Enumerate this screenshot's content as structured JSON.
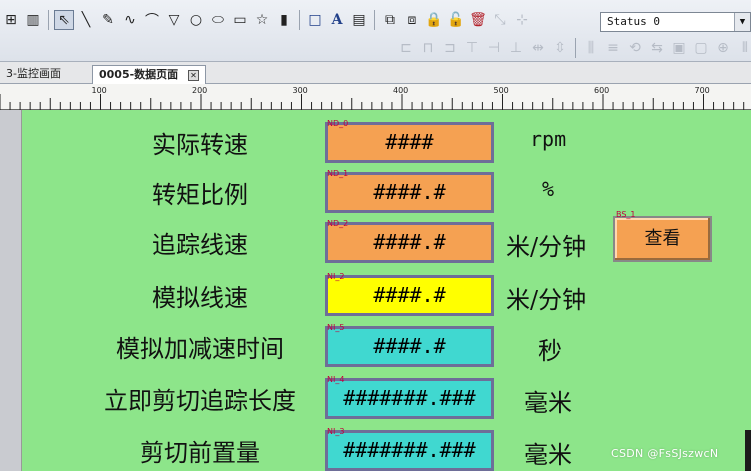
{
  "toolbar": {
    "row1_icons": [
      {
        "name": "grid-icon",
        "glyph": "⊞",
        "style": ""
      },
      {
        "name": "chart-icon",
        "glyph": "▥",
        "style": ""
      },
      {
        "name": "sep",
        "glyph": "",
        "style": "sep"
      },
      {
        "name": "select-pointer-icon",
        "glyph": "⇖",
        "style": "sel"
      },
      {
        "name": "line-tool-icon",
        "glyph": "╲",
        "style": ""
      },
      {
        "name": "pen-tool-icon",
        "glyph": "✎",
        "style": ""
      },
      {
        "name": "polyline-tool-icon",
        "glyph": "∿",
        "style": ""
      },
      {
        "name": "arc-tool-icon",
        "glyph": "⌒",
        "style": ""
      },
      {
        "name": "polygon-tool-icon",
        "glyph": "▽",
        "style": ""
      },
      {
        "name": "circle-tool-icon",
        "glyph": "○",
        "style": ""
      },
      {
        "name": "ellipse-tool-icon",
        "glyph": "⬭",
        "style": ""
      },
      {
        "name": "rectangle-tool-icon",
        "glyph": "▭",
        "style": ""
      },
      {
        "name": "star-tool-icon",
        "glyph": "☆",
        "style": ""
      },
      {
        "name": "bar-tool-icon",
        "glyph": "▮",
        "style": ""
      },
      {
        "name": "sep",
        "glyph": "",
        "style": "sep"
      },
      {
        "name": "frame-tool-icon",
        "glyph": "□",
        "style": "blue"
      },
      {
        "name": "text-tool-icon",
        "glyph": "A",
        "style": "blue"
      },
      {
        "name": "picture-tool-icon",
        "glyph": "▤",
        "style": ""
      },
      {
        "name": "sep",
        "glyph": "",
        "style": "sep"
      },
      {
        "name": "group-icon",
        "glyph": "⧉",
        "style": ""
      },
      {
        "name": "ungroup-icon",
        "glyph": "⧈",
        "style": ""
      },
      {
        "name": "lock-icon",
        "glyph": "🔒",
        "style": "dim"
      },
      {
        "name": "unlock-icon",
        "glyph": "🔓",
        "style": "dim"
      },
      {
        "name": "delete-icon",
        "glyph": "🗑",
        "style": "red"
      },
      {
        "name": "resize-icon",
        "glyph": "⤡",
        "style": "dim"
      },
      {
        "name": "grid-snap-icon",
        "glyph": "⊹",
        "style": "dim"
      }
    ],
    "row2_icons": [
      {
        "name": "align-left-icon",
        "glyph": "⊏"
      },
      {
        "name": "align-center-icon",
        "glyph": "⊓"
      },
      {
        "name": "align-right-icon",
        "glyph": "⊐"
      },
      {
        "name": "align-top-icon",
        "glyph": "⊤"
      },
      {
        "name": "align-middle-icon",
        "glyph": "⊣"
      },
      {
        "name": "align-bottom-icon",
        "glyph": "⊥"
      },
      {
        "name": "same-width-icon",
        "glyph": "⇹"
      },
      {
        "name": "same-height-icon",
        "glyph": "⇳"
      },
      {
        "name": "sep",
        "glyph": ""
      },
      {
        "name": "distribute-h-icon",
        "glyph": "⫼"
      },
      {
        "name": "distribute-v-icon",
        "glyph": "≡"
      },
      {
        "name": "rotate-icon",
        "glyph": "⟲"
      },
      {
        "name": "flip-icon",
        "glyph": "⇆"
      },
      {
        "name": "bring-front-icon",
        "glyph": "▣"
      },
      {
        "name": "send-back-icon",
        "glyph": "▢"
      },
      {
        "name": "center-icon",
        "glyph": "⊕"
      },
      {
        "name": "spacing-icon",
        "glyph": "⫴"
      }
    ],
    "status_select": {
      "value": "Status 0"
    }
  },
  "tabs": {
    "tab1_label": "3-监控画面",
    "tab2_label": "0005-数据页面"
  },
  "ruler": {
    "labels": [
      "100",
      "200",
      "300",
      "400",
      "500",
      "600",
      "700"
    ]
  },
  "rows": [
    {
      "label": "实际转速",
      "id": "ND_0",
      "value": "####",
      "unit": "rpm",
      "color": "orange"
    },
    {
      "label": "转矩比例",
      "id": "ND_1",
      "value": "####.#",
      "unit": "%",
      "color": "orange"
    },
    {
      "label": "追踪线速",
      "id": "ND_2",
      "value": "####.#",
      "unit": "米/分钟",
      "color": "orange"
    },
    {
      "label": "模拟线速",
      "id": "NI_2",
      "value": "####.#",
      "unit": "米/分钟",
      "color": "yellow"
    },
    {
      "label": "模拟加减速时间",
      "id": "NI_5",
      "value": "####.#",
      "unit": "秒",
      "color": "cyan"
    },
    {
      "label": "立即剪切追踪长度",
      "id": "NI_4",
      "value": "#######.###",
      "unit": "毫米",
      "color": "cyan"
    },
    {
      "label": "剪切前置量",
      "id": "NI_3",
      "value": "#######.###",
      "unit": "毫米",
      "color": "cyan"
    }
  ],
  "view_button": {
    "id": "BS_1",
    "label": "查看"
  },
  "watermark": "CSDN @FsSJszwcN",
  "colors": {
    "canvas_bg": "#8de58a",
    "field_orange": "#f5a152",
    "field_yellow": "#ffff00",
    "field_cyan": "#40d8d0",
    "field_border": "#6e6e98",
    "field_id_text": "#c0003c"
  }
}
